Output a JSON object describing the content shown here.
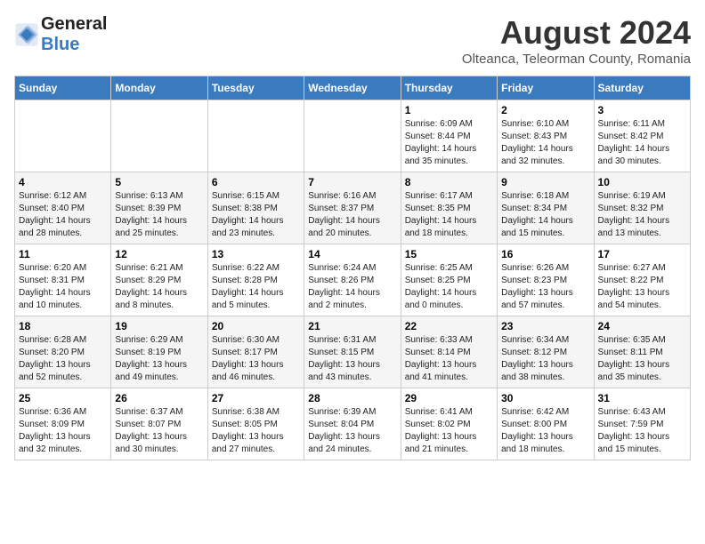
{
  "header": {
    "logo_general": "General",
    "logo_blue": "Blue",
    "title": "August 2024",
    "subtitle": "Olteanca, Teleorman County, Romania"
  },
  "weekdays": [
    "Sunday",
    "Monday",
    "Tuesday",
    "Wednesday",
    "Thursday",
    "Friday",
    "Saturday"
  ],
  "weeks": [
    [
      {
        "day": "",
        "info": ""
      },
      {
        "day": "",
        "info": ""
      },
      {
        "day": "",
        "info": ""
      },
      {
        "day": "",
        "info": ""
      },
      {
        "day": "1",
        "info": "Sunrise: 6:09 AM\nSunset: 8:44 PM\nDaylight: 14 hours and 35 minutes."
      },
      {
        "day": "2",
        "info": "Sunrise: 6:10 AM\nSunset: 8:43 PM\nDaylight: 14 hours and 32 minutes."
      },
      {
        "day": "3",
        "info": "Sunrise: 6:11 AM\nSunset: 8:42 PM\nDaylight: 14 hours and 30 minutes."
      }
    ],
    [
      {
        "day": "4",
        "info": "Sunrise: 6:12 AM\nSunset: 8:40 PM\nDaylight: 14 hours and 28 minutes."
      },
      {
        "day": "5",
        "info": "Sunrise: 6:13 AM\nSunset: 8:39 PM\nDaylight: 14 hours and 25 minutes."
      },
      {
        "day": "6",
        "info": "Sunrise: 6:15 AM\nSunset: 8:38 PM\nDaylight: 14 hours and 23 minutes."
      },
      {
        "day": "7",
        "info": "Sunrise: 6:16 AM\nSunset: 8:37 PM\nDaylight: 14 hours and 20 minutes."
      },
      {
        "day": "8",
        "info": "Sunrise: 6:17 AM\nSunset: 8:35 PM\nDaylight: 14 hours and 18 minutes."
      },
      {
        "day": "9",
        "info": "Sunrise: 6:18 AM\nSunset: 8:34 PM\nDaylight: 14 hours and 15 minutes."
      },
      {
        "day": "10",
        "info": "Sunrise: 6:19 AM\nSunset: 8:32 PM\nDaylight: 14 hours and 13 minutes."
      }
    ],
    [
      {
        "day": "11",
        "info": "Sunrise: 6:20 AM\nSunset: 8:31 PM\nDaylight: 14 hours and 10 minutes."
      },
      {
        "day": "12",
        "info": "Sunrise: 6:21 AM\nSunset: 8:29 PM\nDaylight: 14 hours and 8 minutes."
      },
      {
        "day": "13",
        "info": "Sunrise: 6:22 AM\nSunset: 8:28 PM\nDaylight: 14 hours and 5 minutes."
      },
      {
        "day": "14",
        "info": "Sunrise: 6:24 AM\nSunset: 8:26 PM\nDaylight: 14 hours and 2 minutes."
      },
      {
        "day": "15",
        "info": "Sunrise: 6:25 AM\nSunset: 8:25 PM\nDaylight: 14 hours and 0 minutes."
      },
      {
        "day": "16",
        "info": "Sunrise: 6:26 AM\nSunset: 8:23 PM\nDaylight: 13 hours and 57 minutes."
      },
      {
        "day": "17",
        "info": "Sunrise: 6:27 AM\nSunset: 8:22 PM\nDaylight: 13 hours and 54 minutes."
      }
    ],
    [
      {
        "day": "18",
        "info": "Sunrise: 6:28 AM\nSunset: 8:20 PM\nDaylight: 13 hours and 52 minutes."
      },
      {
        "day": "19",
        "info": "Sunrise: 6:29 AM\nSunset: 8:19 PM\nDaylight: 13 hours and 49 minutes."
      },
      {
        "day": "20",
        "info": "Sunrise: 6:30 AM\nSunset: 8:17 PM\nDaylight: 13 hours and 46 minutes."
      },
      {
        "day": "21",
        "info": "Sunrise: 6:31 AM\nSunset: 8:15 PM\nDaylight: 13 hours and 43 minutes."
      },
      {
        "day": "22",
        "info": "Sunrise: 6:33 AM\nSunset: 8:14 PM\nDaylight: 13 hours and 41 minutes."
      },
      {
        "day": "23",
        "info": "Sunrise: 6:34 AM\nSunset: 8:12 PM\nDaylight: 13 hours and 38 minutes."
      },
      {
        "day": "24",
        "info": "Sunrise: 6:35 AM\nSunset: 8:11 PM\nDaylight: 13 hours and 35 minutes."
      }
    ],
    [
      {
        "day": "25",
        "info": "Sunrise: 6:36 AM\nSunset: 8:09 PM\nDaylight: 13 hours and 32 minutes."
      },
      {
        "day": "26",
        "info": "Sunrise: 6:37 AM\nSunset: 8:07 PM\nDaylight: 13 hours and 30 minutes."
      },
      {
        "day": "27",
        "info": "Sunrise: 6:38 AM\nSunset: 8:05 PM\nDaylight: 13 hours and 27 minutes."
      },
      {
        "day": "28",
        "info": "Sunrise: 6:39 AM\nSunset: 8:04 PM\nDaylight: 13 hours and 24 minutes."
      },
      {
        "day": "29",
        "info": "Sunrise: 6:41 AM\nSunset: 8:02 PM\nDaylight: 13 hours and 21 minutes."
      },
      {
        "day": "30",
        "info": "Sunrise: 6:42 AM\nSunset: 8:00 PM\nDaylight: 13 hours and 18 minutes."
      },
      {
        "day": "31",
        "info": "Sunrise: 6:43 AM\nSunset: 7:59 PM\nDaylight: 13 hours and 15 minutes."
      }
    ]
  ]
}
